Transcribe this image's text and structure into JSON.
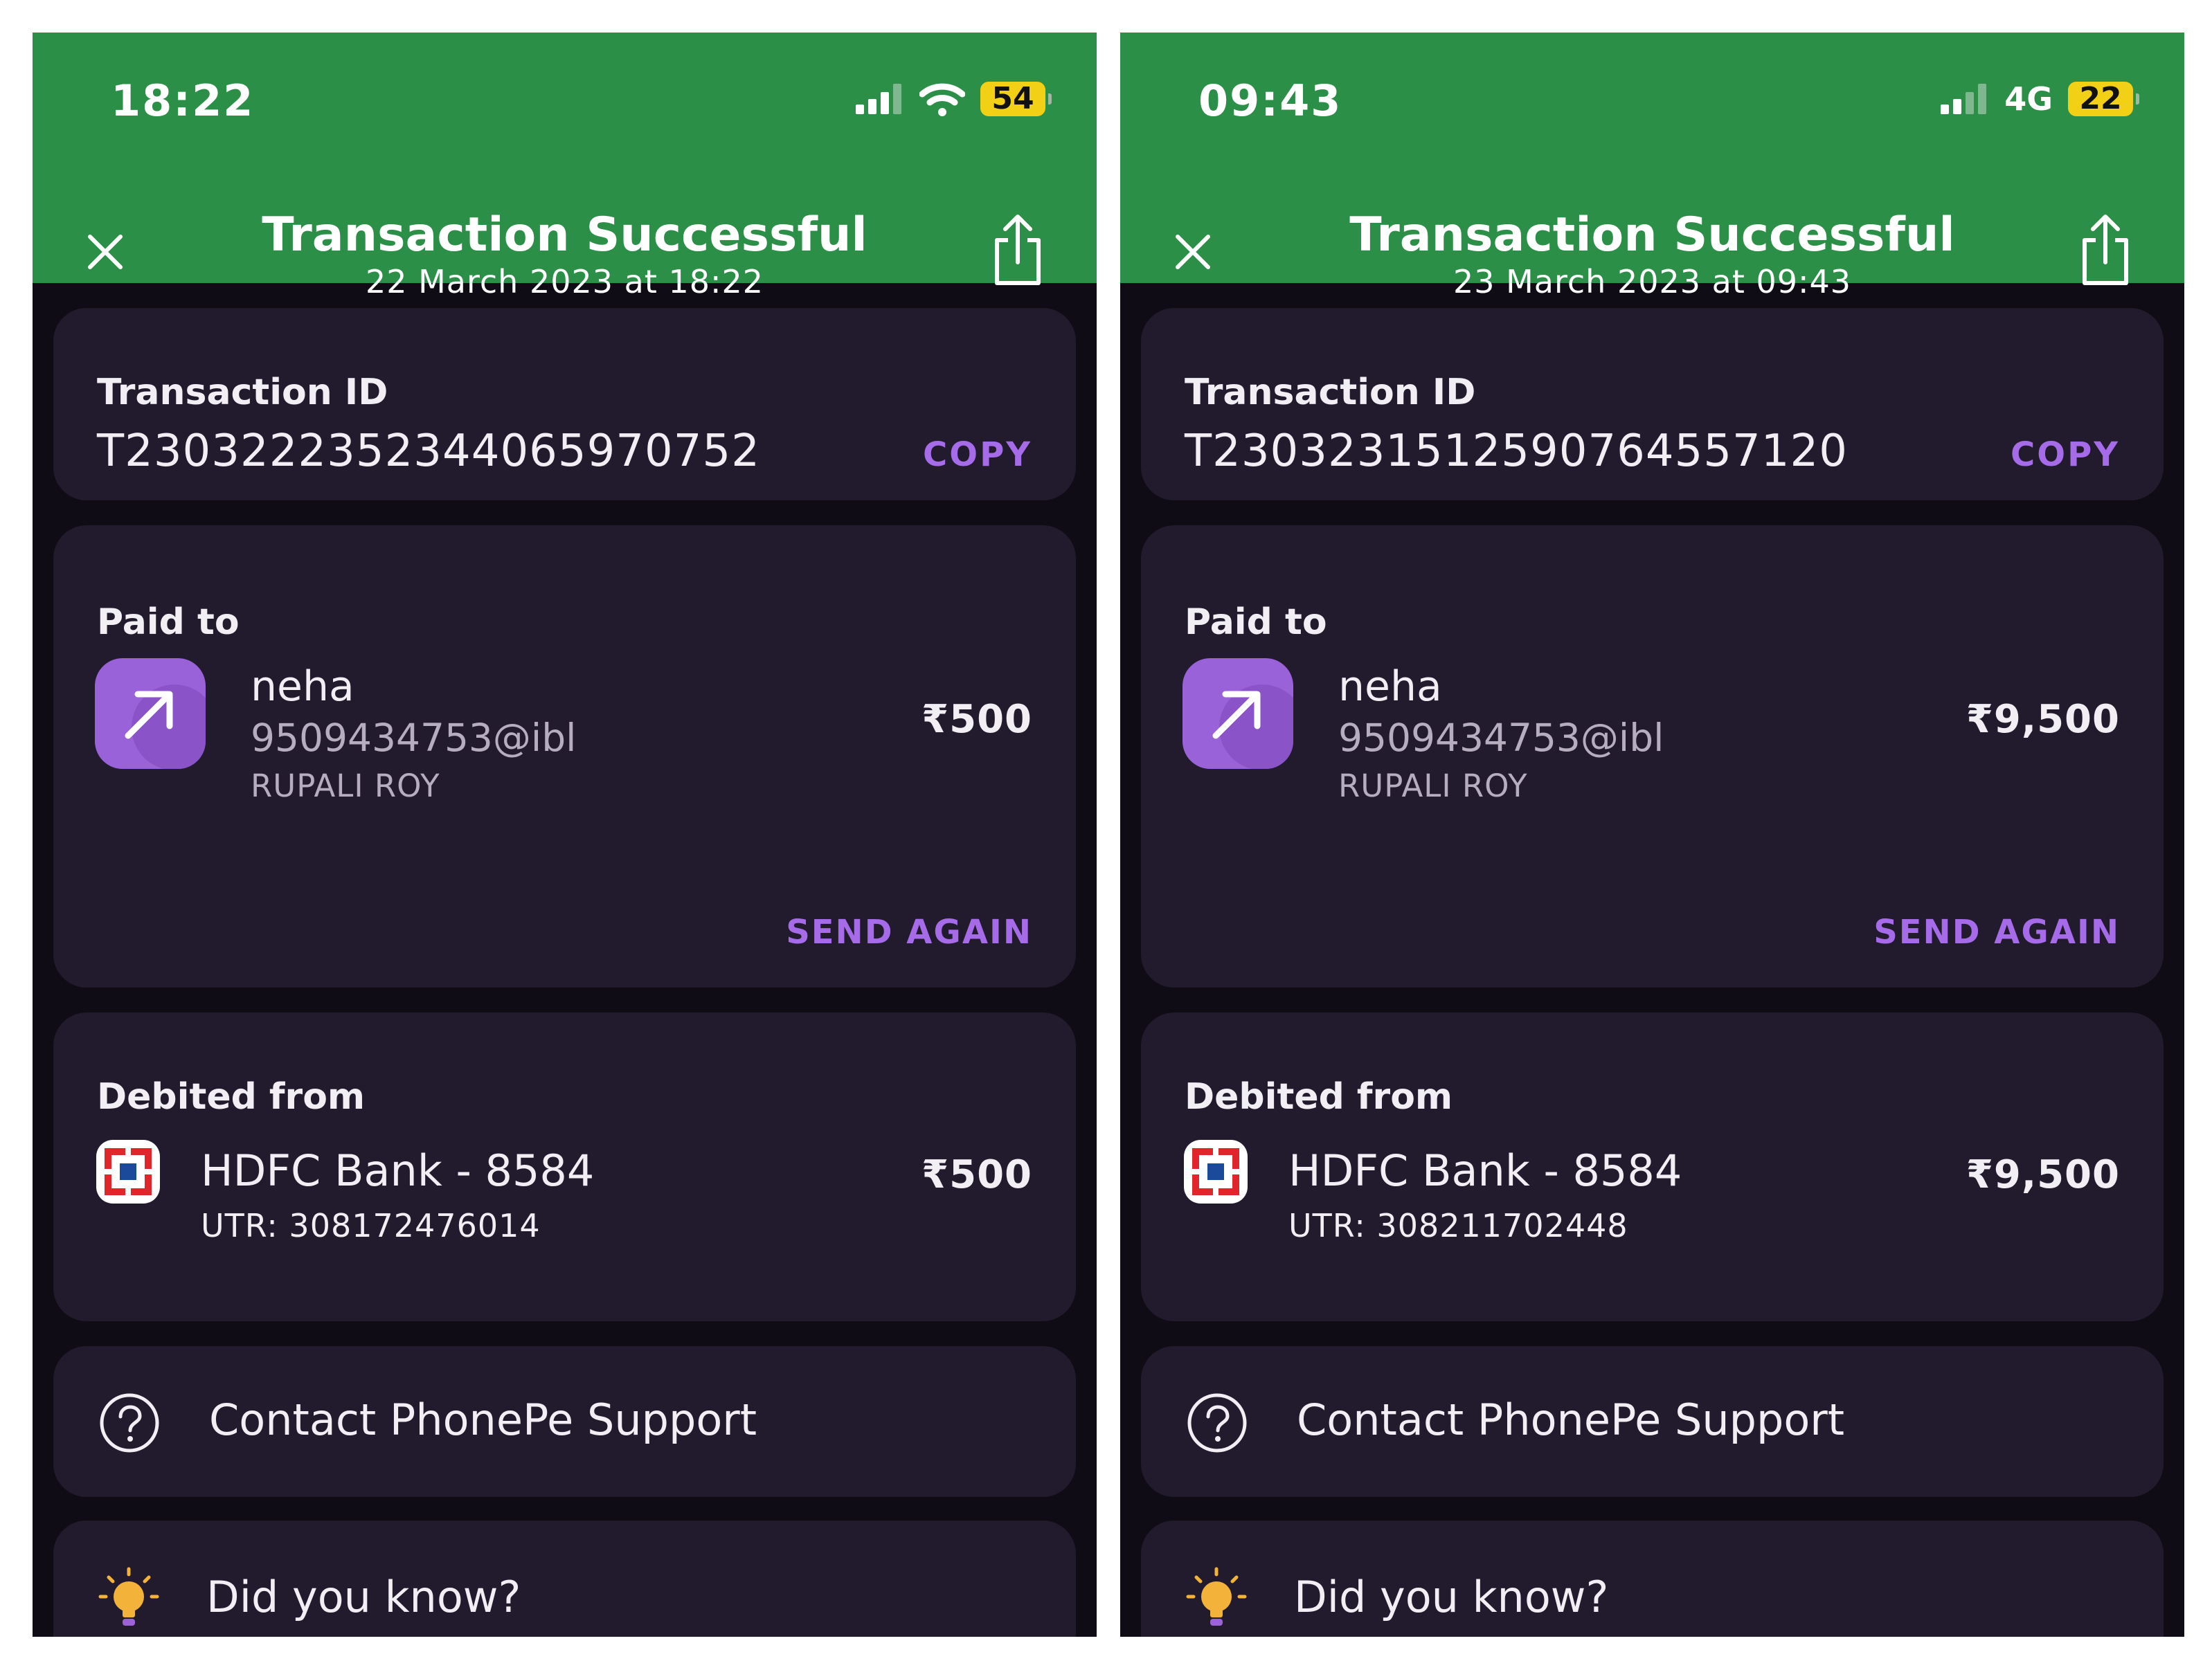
{
  "screens": [
    {
      "status_time": "18:22",
      "network_label": "",
      "battery": "54",
      "title": "Transaction Successful",
      "subtitle": "22 March 2023 at 18:22",
      "transaction_id_label": "Transaction ID",
      "transaction_id": "T2303222352344065970752",
      "copy_label": "COPY",
      "paid_to_label": "Paid to",
      "payee_name": "neha",
      "payee_upi": "9509434753@ibl",
      "payee_bank_name": "RUPALI ROY",
      "amount": "₹500",
      "send_again_label": "SEND AGAIN",
      "debited_from_label": "Debited from",
      "bank_account": "HDFC Bank - 8584",
      "utr": "UTR: 308172476014",
      "debited_amount": "₹500",
      "support_label": "Contact PhonePe Support",
      "did_you_know_label": "Did you know?"
    },
    {
      "status_time": "09:43",
      "network_label": "4G",
      "battery": "22",
      "title": "Transaction Successful",
      "subtitle": "23 March 2023 at 09:43",
      "transaction_id_label": "Transaction ID",
      "transaction_id": "T2303231512590764557120",
      "copy_label": "COPY",
      "paid_to_label": "Paid to",
      "payee_name": "neha",
      "payee_upi": "9509434753@ibl",
      "payee_bank_name": "RUPALI ROY",
      "amount": "₹9,500",
      "send_again_label": "SEND AGAIN",
      "debited_from_label": "Debited from",
      "bank_account": "HDFC Bank - 8584",
      "utr": "UTR: 308211702448",
      "debited_amount": "₹9,500",
      "support_label": "Contact PhonePe Support",
      "did_you_know_label": "Did you know?"
    }
  ],
  "icons": {
    "close": "close-icon",
    "share": "share-icon",
    "signal": "signal-icon",
    "wifi": "wifi-icon",
    "payee": "arrow-up-right-icon",
    "bank": "hdfc-bank-logo",
    "support": "question-circle-icon",
    "tip": "lightbulb-icon"
  },
  "colors": {
    "header_green": "#2c8f47",
    "background": "#100c15",
    "card": "#221a2d",
    "accent_purple": "#a66be8",
    "battery_yellow": "#f1d016",
    "bank_red": "#e0262b"
  }
}
